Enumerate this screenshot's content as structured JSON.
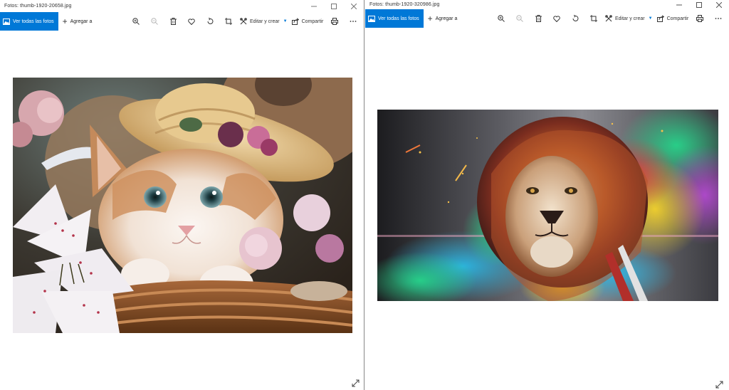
{
  "windows": [
    {
      "id": "left",
      "title": "Fotos: thumb-1920-20658.jpg",
      "view_all_label": "Ver todas las fotos",
      "add_to_label": "Agregar a",
      "edit_create_label": "Editar y crear",
      "share_label": "Compartir",
      "photo_subject": "kitten-in-straw-hat"
    },
    {
      "id": "right",
      "title": "Fotos: thumb-1920-320986.jpg",
      "view_all_label": "Ver todas las fotos",
      "add_to_label": "Agregar a",
      "edit_create_label": "Editar y crear",
      "share_label": "Compartir",
      "photo_subject": "rainbow-lion"
    }
  ],
  "icons": {
    "window_controls": [
      "minimize-icon",
      "maximize-icon",
      "close-icon"
    ],
    "toolbar": [
      "zoom-in-icon",
      "zoom-out-icon",
      "delete-icon",
      "favorite-icon",
      "rotate-icon",
      "crop-icon",
      "edit-create-icon",
      "share-icon",
      "print-icon",
      "more-icon"
    ],
    "corner": "expand-icon"
  },
  "colors": {
    "accent": "#0078d7",
    "titlebar_bg": "#ffffff",
    "canvas_bg": "#ffffff",
    "window_border": "#888888"
  }
}
